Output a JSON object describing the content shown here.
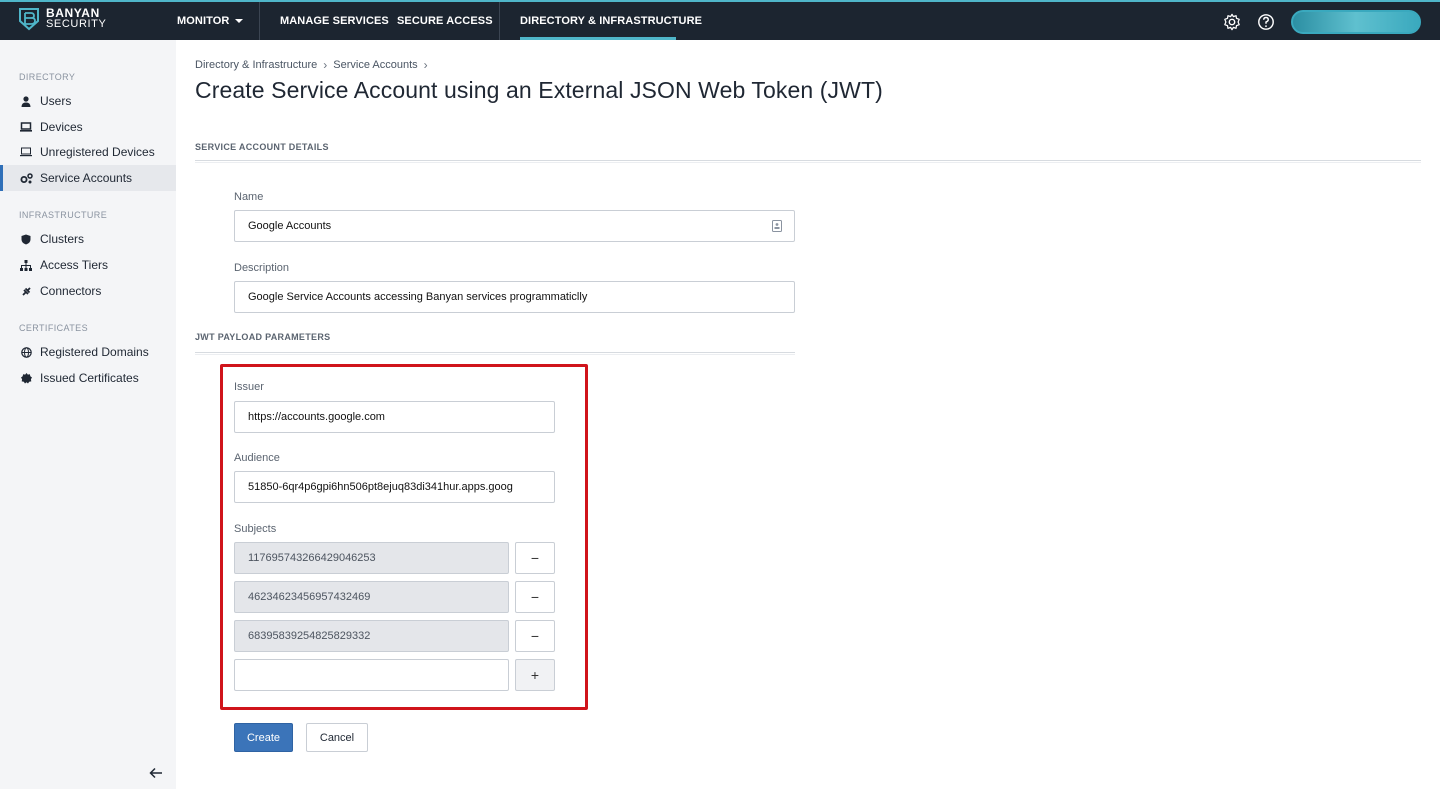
{
  "brand": {
    "name": "BANYAN",
    "sub": "SECURITY",
    "accent": "#4fb6c9",
    "topbar_color": "#1c2530"
  },
  "topnav": {
    "monitor": "MONITOR",
    "manage_services": "MANAGE SERVICES",
    "secure_access": "SECURE ACCESS",
    "directory_infrastructure": "DIRECTORY & INFRASTRUCTURE",
    "active": "DIRECTORY & INFRASTRUCTURE",
    "icons": [
      "gear-icon",
      "help-icon"
    ]
  },
  "sidebar": {
    "sections": [
      {
        "title": "DIRECTORY",
        "items": [
          {
            "label": "Users",
            "icon": "user-icon"
          },
          {
            "label": "Devices",
            "icon": "laptop-icon"
          },
          {
            "label": "Unregistered Devices",
            "icon": "laptop-outline-icon"
          },
          {
            "label": "Service Accounts",
            "icon": "gears-icon",
            "active": true
          }
        ]
      },
      {
        "title": "INFRASTRUCTURE",
        "items": [
          {
            "label": "Clusters",
            "icon": "shield-icon"
          },
          {
            "label": "Access Tiers",
            "icon": "hierarchy-icon"
          },
          {
            "label": "Connectors",
            "icon": "plug-icon"
          }
        ]
      },
      {
        "title": "CERTIFICATES",
        "items": [
          {
            "label": "Registered Domains",
            "icon": "globe-icon"
          },
          {
            "label": "Issued Certificates",
            "icon": "certificate-icon"
          }
        ]
      }
    ]
  },
  "breadcrumb": [
    "Directory & Infrastructure",
    "Service Accounts"
  ],
  "page_title": "Create Service Account using an External JSON Web Token (JWT)",
  "details": {
    "heading": "SERVICE ACCOUNT DETAILS",
    "name_label": "Name",
    "name_value": "Google Accounts",
    "description_label": "Description",
    "description_value": "Google Service Accounts accessing Banyan services programmaticlly"
  },
  "jwt": {
    "heading": "JWT PAYLOAD PARAMETERS",
    "issuer_label": "Issuer",
    "issuer_value": "https://accounts.google.com",
    "audience_label": "Audience",
    "audience_value": "51850-6qr4p6gpi6hn506pt8ejuq83di341hur.apps.goog",
    "subjects_label": "Subjects",
    "subjects": [
      "117695743266429046253",
      "46234623456957432469",
      "68395839254825829332"
    ],
    "new_subject_value": "",
    "remove_symbol": "−",
    "add_symbol": "+"
  },
  "actions": {
    "create": "Create",
    "cancel": "Cancel"
  },
  "colors": {
    "primary_button": "#3b74b9",
    "highlight": "#d0141b",
    "active_nav": "#2f6fb8"
  }
}
